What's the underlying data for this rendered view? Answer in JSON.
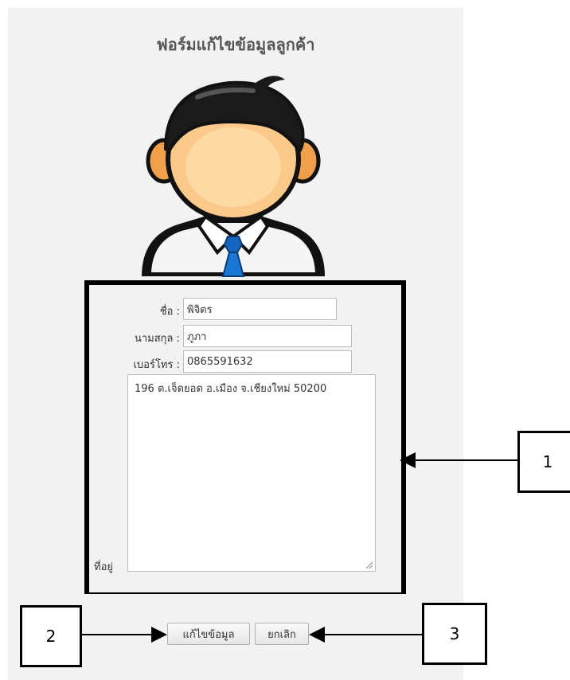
{
  "form": {
    "title": "ฟอร์มแก้ไขข้อมูลลูกค้า",
    "name_label": "ชื่อ :",
    "name_value": "พิจิตร",
    "surname_label": "นามสกุล :",
    "surname_value": "ภูภา",
    "phone_label": "เบอร์โทร :",
    "phone_value": "0865591632",
    "address_label": "ที่อยู่",
    "address_value": "196 ต.เจ็ดยอด อ.เมือง จ.เชียงใหม่ 50200"
  },
  "buttons": {
    "edit_label": "แก้ไขข้อมูล",
    "cancel_label": "ยกเลิก"
  },
  "callouts": {
    "one": "1",
    "two": "2",
    "three": "3"
  },
  "icons": {
    "avatar": "user-avatar-icon"
  }
}
